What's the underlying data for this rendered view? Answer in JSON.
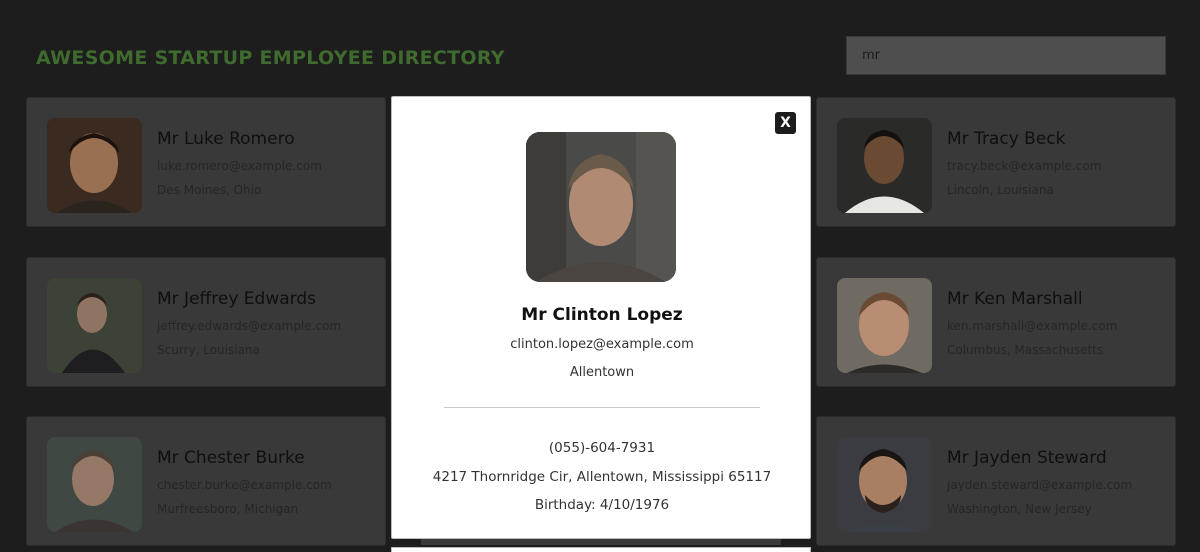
{
  "header": {
    "title": "AWESOME STARTUP EMPLOYEE DIRECTORY",
    "search_value": "mr",
    "title_color": "#3f6b2e"
  },
  "employees": [
    {
      "name": "Mr Luke Romero",
      "email": "luke.romero@example.com",
      "location": "Des Moines, Ohio",
      "skin": "#9a7052",
      "hair": "#1b120d",
      "bg": "#3b2a20"
    },
    {
      "name": "Mr Tracy Beck",
      "email": "tracy.beck@example.com",
      "location": "Lincoln, Louisiana",
      "skin": "#6b4a34",
      "hair": "#141010",
      "bg": "#2a2a28"
    },
    {
      "name": "Mr Jeffrey Edwards",
      "email": "jeffrey.edwards@example.com",
      "location": "Scurry, Louisiana",
      "skin": "#8e7461",
      "hair": "#2a211b",
      "bg": "#3d4236"
    },
    {
      "name": "Mr Ken Marshall",
      "email": "ken.marshall@example.com",
      "location": "Columbus, Massachusetts",
      "skin": "#b88d74",
      "hair": "#6b4a33",
      "bg": "#6f6a62"
    },
    {
      "name": "Mr Chester Burke",
      "email": "chester.burke@example.com",
      "location": "Murfreesboro, Michigan",
      "skin": "#967866",
      "hair": "#4b4038",
      "bg": "#404844"
    },
    {
      "name": "Mr Jayden Steward",
      "email": "jayden.steward@example.com",
      "location": "Washington, New Jersey",
      "skin": "#a97f63",
      "hair": "#1a1512",
      "bg": "#3a3c42"
    }
  ],
  "modal": {
    "close_label": "X",
    "name": "Mr Clinton Lopez",
    "email": "clinton.lopez@example.com",
    "city": "Allentown",
    "phone": "(055)-604-7931",
    "address": "4217 Thornridge Cir, Allentown, Mississippi 65117",
    "birthday": "Birthday: 4/10/1976",
    "skin": "#b08a72",
    "hair": "#6a5a4a",
    "bg": "#4a4a48"
  },
  "colors": {
    "background": "#1d1d1d",
    "card": "#393939",
    "modal": "#ffffff"
  }
}
